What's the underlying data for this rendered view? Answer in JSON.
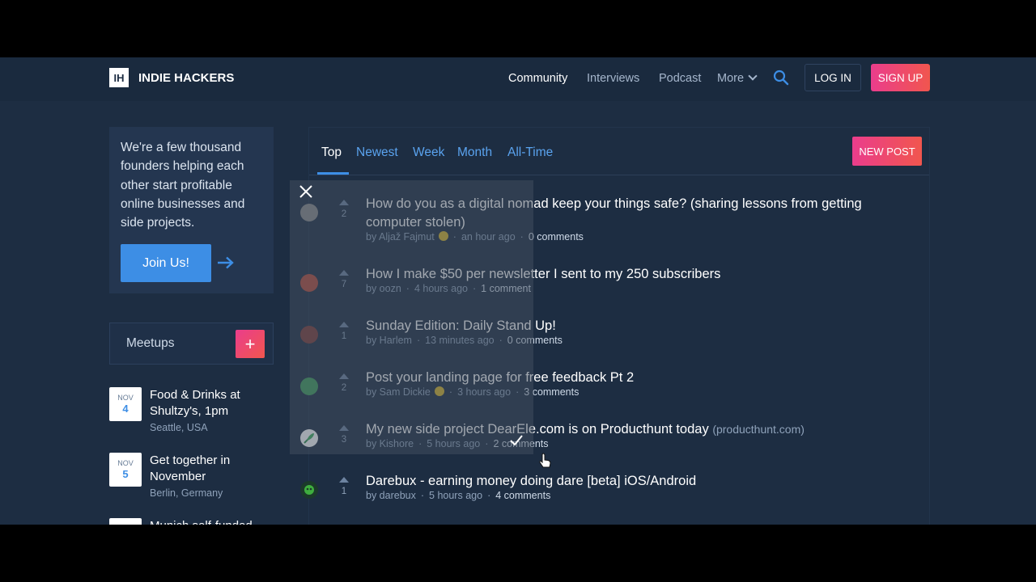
{
  "header": {
    "logo_mark": "IH",
    "logo_text": "INDIE HACKERS",
    "nav": [
      {
        "label": "Community",
        "active": true
      },
      {
        "label": "Interviews"
      },
      {
        "label": "Podcast"
      },
      {
        "label": "More"
      }
    ],
    "login_label": "LOG IN",
    "signup_label": "SIGN UP",
    "icons": {
      "search": "search-icon",
      "more": "chevron-down-icon"
    }
  },
  "sidebar": {
    "intro_text": "We're a few thousand founders helping each other start profitable online businesses and side projects.",
    "join_label": "Join Us!",
    "meetups_title": "Meetups",
    "meetups": [
      {
        "month": "NOV",
        "day": "4",
        "title": "Food & Drinks at Shultzy's, 1pm",
        "location": "Seattle, USA"
      },
      {
        "month": "NOV",
        "day": "5",
        "title": "Get together in November",
        "location": "Berlin, Germany"
      },
      {
        "month": "",
        "day": "",
        "title": "Munich self-funded",
        "location": ""
      }
    ]
  },
  "feed": {
    "tabs": [
      {
        "label": "Top",
        "active": true
      },
      {
        "label": "Newest"
      },
      {
        "label": "Week"
      },
      {
        "label": "Month"
      },
      {
        "label": "All-Time"
      }
    ],
    "new_post_label": "NEW POST",
    "posts": [
      {
        "title": "How do you as a digital nomad keep your things safe? (sharing lessons from getting computer stolen)",
        "domain": "",
        "votes": "2",
        "author": "by Aljaž Fajmut",
        "badge": true,
        "time": "an hour ago",
        "comments": "0 comments"
      },
      {
        "title": "How I make $50 per newsletter I sent to my 250 subscribers",
        "domain": "",
        "votes": "7",
        "author": "by oozn",
        "badge": false,
        "time": "4 hours ago",
        "comments": "1 comment"
      },
      {
        "title": "Sunday Edition: Daily Stand Up!",
        "domain": "",
        "votes": "1",
        "author": "by Harlem",
        "badge": false,
        "time": "13 minutes ago",
        "comments": "0 comments"
      },
      {
        "title": "Post your landing page for free feedback Pt 2",
        "domain": "",
        "votes": "2",
        "author": "by Sam Dickie",
        "badge": true,
        "time": "3 hours ago",
        "comments": "3 comments"
      },
      {
        "title": "My new side project DearEle.com is on Producthunt today",
        "domain": "(producthunt.com)",
        "votes": "3",
        "author": "by Kishore",
        "badge": false,
        "time": "5 hours ago",
        "comments": "2 comments"
      },
      {
        "title": "Darebux - earning money doing dare [beta] iOS/Android",
        "domain": "",
        "votes": "1",
        "author": "by darebux",
        "badge": false,
        "time": "5 hours ago",
        "comments": "4 comments"
      }
    ]
  },
  "colors": {
    "background": "#1d2d42",
    "header": "#1a2a3e",
    "accent_blue": "#3d8ee5",
    "accent_pink": "#ea3d8c",
    "accent_orange": "#f1564e"
  }
}
